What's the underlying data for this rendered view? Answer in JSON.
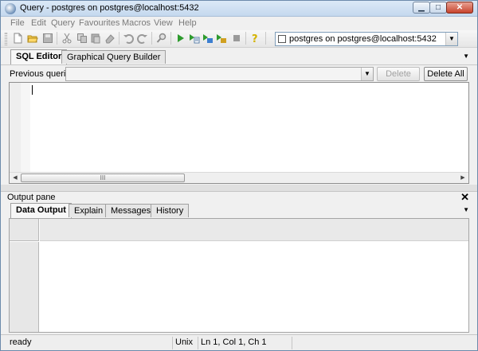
{
  "window": {
    "title": "Query - postgres on postgres@localhost:5432",
    "minimize": "▁",
    "maximize": "□",
    "close": "✕"
  },
  "menu": [
    "File",
    "Edit",
    "Query",
    "Favourites",
    "Macros",
    "View",
    "Help"
  ],
  "toolbar": {
    "connection": "postgres on postgres@localhost:5432",
    "icons": [
      "new-file-icon",
      "open-folder-icon",
      "save-icon",
      "cut-icon",
      "copy-icon",
      "paste-icon",
      "clear-icon",
      "undo-icon",
      "redo-icon",
      "find-icon",
      "execute-icon",
      "execute-to-file-icon",
      "explain-icon",
      "explain-analyze-icon",
      "cancel-icon",
      "help-icon"
    ]
  },
  "editor_tabs": [
    "SQL Editor",
    "Graphical Query Builder"
  ],
  "previous_queries": {
    "label": "Previous queries",
    "value": "",
    "delete_label": "Delete",
    "delete_all_label": "Delete All"
  },
  "editor": {
    "content": "",
    "scroll_thumb": "III"
  },
  "output": {
    "label": "Output pane",
    "close": "✕",
    "tabs": [
      "Data Output",
      "Explain",
      "Messages",
      "History"
    ]
  },
  "status": {
    "state": "ready",
    "encoding": "Unix",
    "position": "Ln 1, Col 1, Ch 1"
  },
  "colors": {
    "titlebar": "#c4d8ee",
    "close_button": "#c7432c",
    "execute": "#2e9b2e",
    "help": "#d4b300"
  }
}
